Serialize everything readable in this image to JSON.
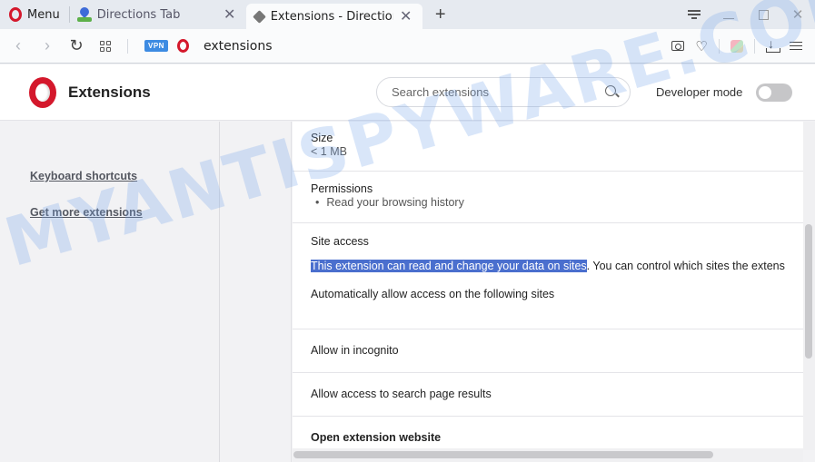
{
  "tabstrip": {
    "menu_label": "Menu",
    "tabs": [
      {
        "title": "Directions Tab",
        "icon": "map-pin-icon",
        "active": false
      },
      {
        "title": "Extensions - Directions Tab",
        "icon": "extension-cube-icon",
        "active": true
      }
    ],
    "new_tab_symbol": "+",
    "close_symbol": "✕"
  },
  "toolbar": {
    "back_symbol": "‹",
    "forward_symbol": "›",
    "reload_symbol": "↻",
    "vpn_label": "VPN",
    "url": "extensions",
    "heart_symbol": "♡"
  },
  "header": {
    "title": "Extensions",
    "search_placeholder": "Search extensions",
    "developer_mode_label": "Developer mode",
    "developer_mode_on": false
  },
  "sidebar": {
    "links": [
      {
        "label": "Keyboard shortcuts"
      },
      {
        "label": "Get more extensions"
      }
    ]
  },
  "details": {
    "size": {
      "label": "Size",
      "value": "< 1 MB"
    },
    "permissions": {
      "label": "Permissions",
      "items": [
        "Read your browsing history"
      ]
    },
    "site_access": {
      "label": "Site access",
      "description_selected": "This extension can read and change your data on sites",
      "description_rest": ". You can control which sites the extens",
      "auto_allow_label": "Automatically allow access on the following sites"
    },
    "allow_incognito_label": "Allow in incognito",
    "allow_search_results_label": "Allow access to search page results",
    "open_website_label": "Open extension website"
  },
  "watermark": "MYANTISPYWARE.COM",
  "colors": {
    "opera_red": "#d4182c",
    "selection": "#4a6fce",
    "vpn_blue": "#3d8be2"
  }
}
